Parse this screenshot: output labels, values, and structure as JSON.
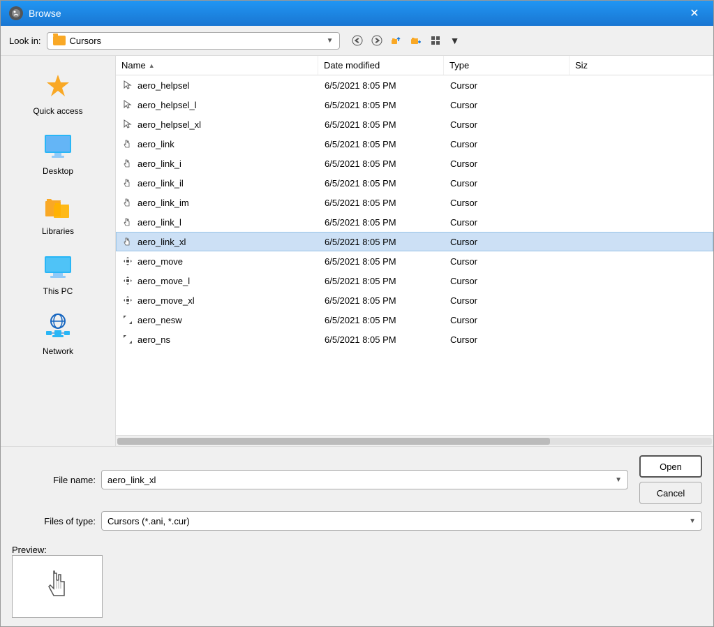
{
  "title_bar": {
    "title": "Browse",
    "close_label": "✕"
  },
  "toolbar": {
    "look_in_label": "Look in:",
    "look_in_value": "Cursors",
    "back_btn": "←",
    "forward_btn": "→",
    "up_btn": "↑",
    "new_folder_btn": "📁",
    "views_btn": "⊞"
  },
  "sidebar": {
    "items": [
      {
        "id": "quick-access",
        "label": "Quick access",
        "icon": "⭐"
      },
      {
        "id": "desktop",
        "label": "Desktop",
        "icon": "🖥"
      },
      {
        "id": "libraries",
        "label": "Libraries",
        "icon": "📁"
      },
      {
        "id": "this-pc",
        "label": "This PC",
        "icon": "💻"
      },
      {
        "id": "network",
        "label": "Network",
        "icon": "🌐"
      }
    ]
  },
  "file_list": {
    "columns": [
      "Name",
      "Date modified",
      "Type",
      "Siz"
    ],
    "sort_arrow": "▲",
    "files": [
      {
        "name": "aero_helpsel",
        "date": "6/5/2021 8:05 PM",
        "type": "Cursor",
        "size": "",
        "selected": false
      },
      {
        "name": "aero_helpsel_l",
        "date": "6/5/2021 8:05 PM",
        "type": "Cursor",
        "size": "",
        "selected": false
      },
      {
        "name": "aero_helpsel_xl",
        "date": "6/5/2021 8:05 PM",
        "type": "Cursor",
        "size": "",
        "selected": false
      },
      {
        "name": "aero_link",
        "date": "6/5/2021 8:05 PM",
        "type": "Cursor",
        "size": "",
        "selected": false
      },
      {
        "name": "aero_link_i",
        "date": "6/5/2021 8:05 PM",
        "type": "Cursor",
        "size": "",
        "selected": false
      },
      {
        "name": "aero_link_il",
        "date": "6/5/2021 8:05 PM",
        "type": "Cursor",
        "size": "",
        "selected": false
      },
      {
        "name": "aero_link_im",
        "date": "6/5/2021 8:05 PM",
        "type": "Cursor",
        "size": "",
        "selected": false
      },
      {
        "name": "aero_link_l",
        "date": "6/5/2021 8:05 PM",
        "type": "Cursor",
        "size": "",
        "selected": false
      },
      {
        "name": "aero_link_xl",
        "date": "6/5/2021 8:05 PM",
        "type": "Cursor",
        "size": "",
        "selected": true
      },
      {
        "name": "aero_move",
        "date": "6/5/2021 8:05 PM",
        "type": "Cursor",
        "size": "",
        "selected": false
      },
      {
        "name": "aero_move_l",
        "date": "6/5/2021 8:05 PM",
        "type": "Cursor",
        "size": "",
        "selected": false
      },
      {
        "name": "aero_move_xl",
        "date": "6/5/2021 8:05 PM",
        "type": "Cursor",
        "size": "",
        "selected": false
      },
      {
        "name": "aero_nesw",
        "date": "6/5/2021 8:05 PM",
        "type": "Cursor",
        "size": "",
        "selected": false
      },
      {
        "name": "aero_ns",
        "date": "6/5/2021 8:05 PM",
        "type": "Cursor",
        "size": "",
        "selected": false
      }
    ]
  },
  "form": {
    "file_name_label": "File name:",
    "file_name_value": "aero_link_xl",
    "files_of_type_label": "Files of type:",
    "files_of_type_value": "Cursors (*.ani, *.cur)",
    "open_btn": "Open",
    "cancel_btn": "Cancel"
  },
  "preview": {
    "label": "Preview:"
  }
}
